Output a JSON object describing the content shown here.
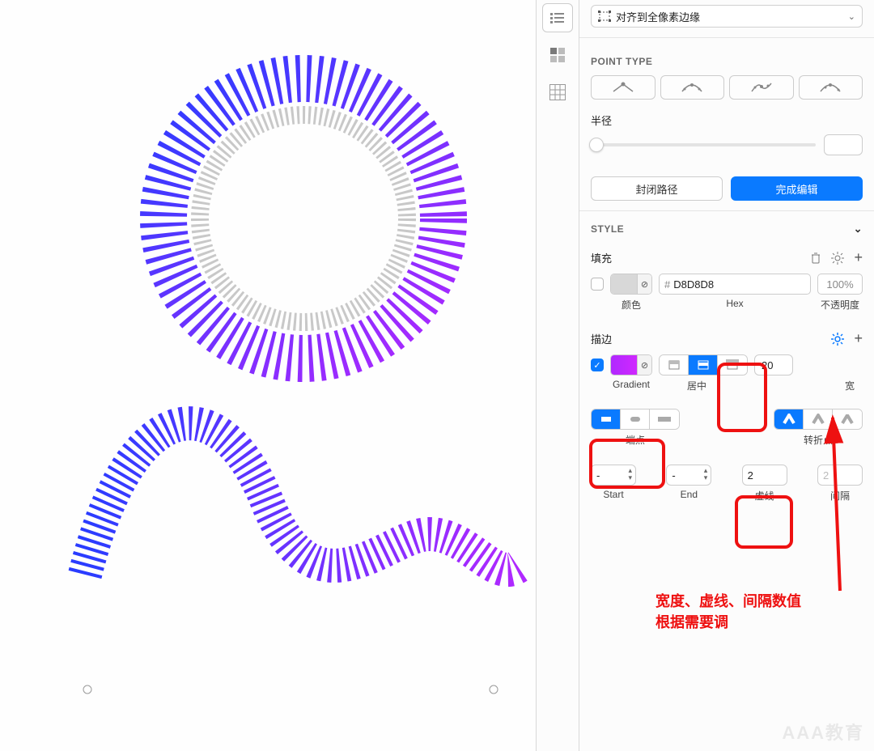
{
  "dropdown": {
    "label": "对齐到全像素边缘"
  },
  "pointType": {
    "title": "POINT TYPE"
  },
  "radius": {
    "label": "半径"
  },
  "pathButtons": {
    "closePath": "封闭路径",
    "finishEdit": "完成编辑"
  },
  "styleSection": {
    "title": "STYLE"
  },
  "fill": {
    "title": "填充",
    "hexPrefix": "#",
    "hexValue": "D8D8D8",
    "opacity": "100",
    "opacityUnit": "%",
    "sublabelColor": "颜色",
    "sublabelHex": "Hex",
    "sublabelOpacity": "不透明度"
  },
  "stroke": {
    "title": "描边",
    "gradientLabel": "Gradient",
    "alignLabel": "居中",
    "widthValue": "20",
    "widthLabel": "宽",
    "capLabel": "端点",
    "joinLabel": "转折点",
    "startValue": "-",
    "startLabel": "Start",
    "endValue": "-",
    "endLabel": "End",
    "dashValue": "2",
    "dashLabel": "虚线",
    "gapValue": "2",
    "gapLabel": "间隔"
  },
  "annotation": {
    "line1": "宽度、虚线、间隔数值",
    "line2": "根据需要调"
  },
  "watermark": "AAA教育"
}
